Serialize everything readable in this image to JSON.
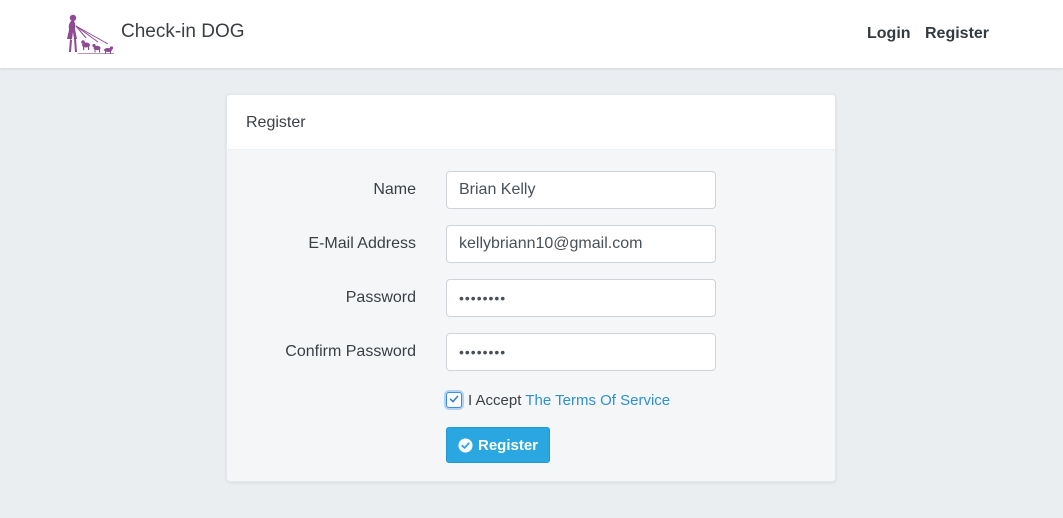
{
  "navbar": {
    "brand": "Check-in DOG",
    "logo_icon": "dog-walker-logo-icon",
    "links": [
      {
        "label": "Login"
      },
      {
        "label": "Register"
      }
    ]
  },
  "card": {
    "title": "Register",
    "fields": {
      "name": {
        "label": "Name",
        "value": "Brian Kelly"
      },
      "email": {
        "label": "E-Mail Address",
        "value": "kellybriann10@gmail.com"
      },
      "password": {
        "label": "Password",
        "value": "••••••••"
      },
      "confirm_password": {
        "label": "Confirm Password",
        "value": "••••••••"
      }
    },
    "terms": {
      "checked": true,
      "prefix": "I Accept",
      "link_label": "The Terms Of Service"
    },
    "submit": {
      "label": "Register",
      "icon": "check-circle-icon"
    }
  },
  "colors": {
    "background": "#ebeef1",
    "accent": "#2aa6e0",
    "link": "#2e8fd1",
    "logo": "#8e4b93"
  }
}
